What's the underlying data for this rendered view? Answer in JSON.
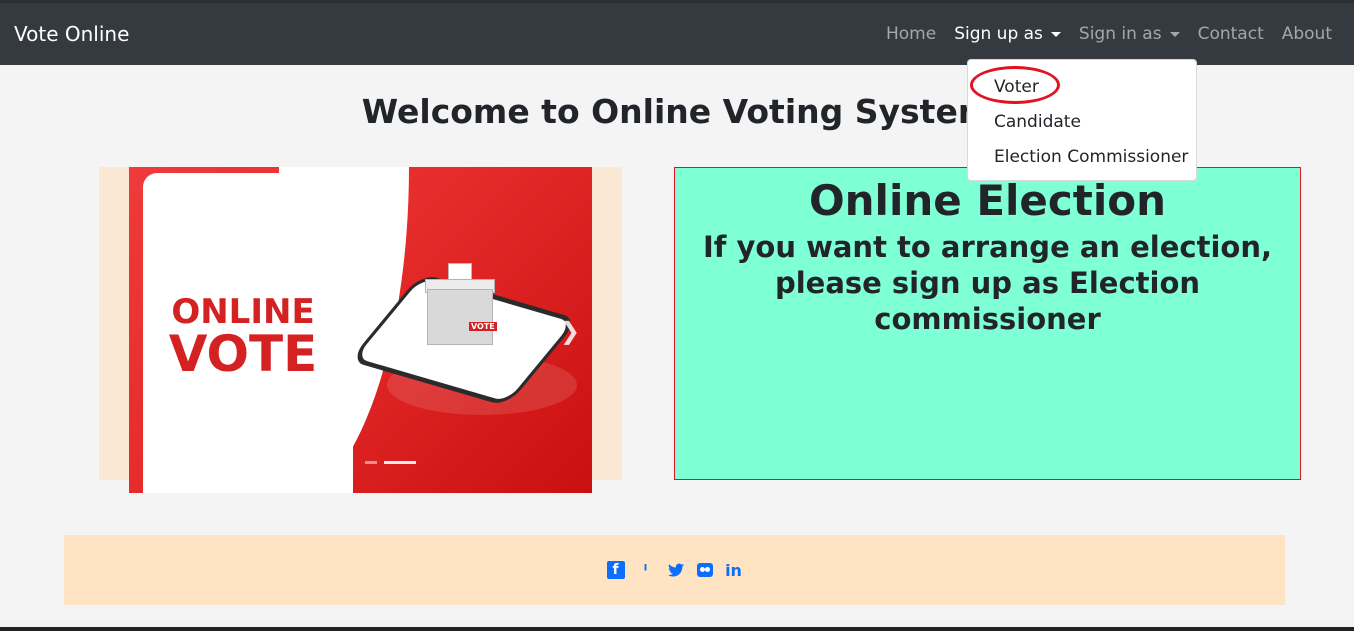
{
  "navbar": {
    "brand": "Vote Online",
    "items": [
      {
        "label": "Home"
      },
      {
        "label": "Sign up as"
      },
      {
        "label": "Sign in as"
      },
      {
        "label": "Contact"
      },
      {
        "label": "About"
      }
    ]
  },
  "signup_dropdown": {
    "items": [
      {
        "label": "Voter"
      },
      {
        "label": "Candidate"
      },
      {
        "label": "Election Commissioner"
      }
    ],
    "highlight_color": "#e0141e"
  },
  "page": {
    "title": "Welcome to Online Voting System"
  },
  "carousel": {
    "slide_text_line1": "ONLINE",
    "slide_text_line2": "VOTE",
    "box_label": "VOTE",
    "next_icon": "chevron-right-icon"
  },
  "election_panel": {
    "heading": "Online Election",
    "message": "If you want to arrange an election, please sign up as Election commissioner",
    "background_color": "#7fffd4"
  },
  "footer": {
    "social_icons": [
      "facebook-icon",
      "pinterest-icon",
      "twitter-icon",
      "flickr-icon",
      "linkedin-icon"
    ],
    "background_color": "#ffe4c4"
  }
}
